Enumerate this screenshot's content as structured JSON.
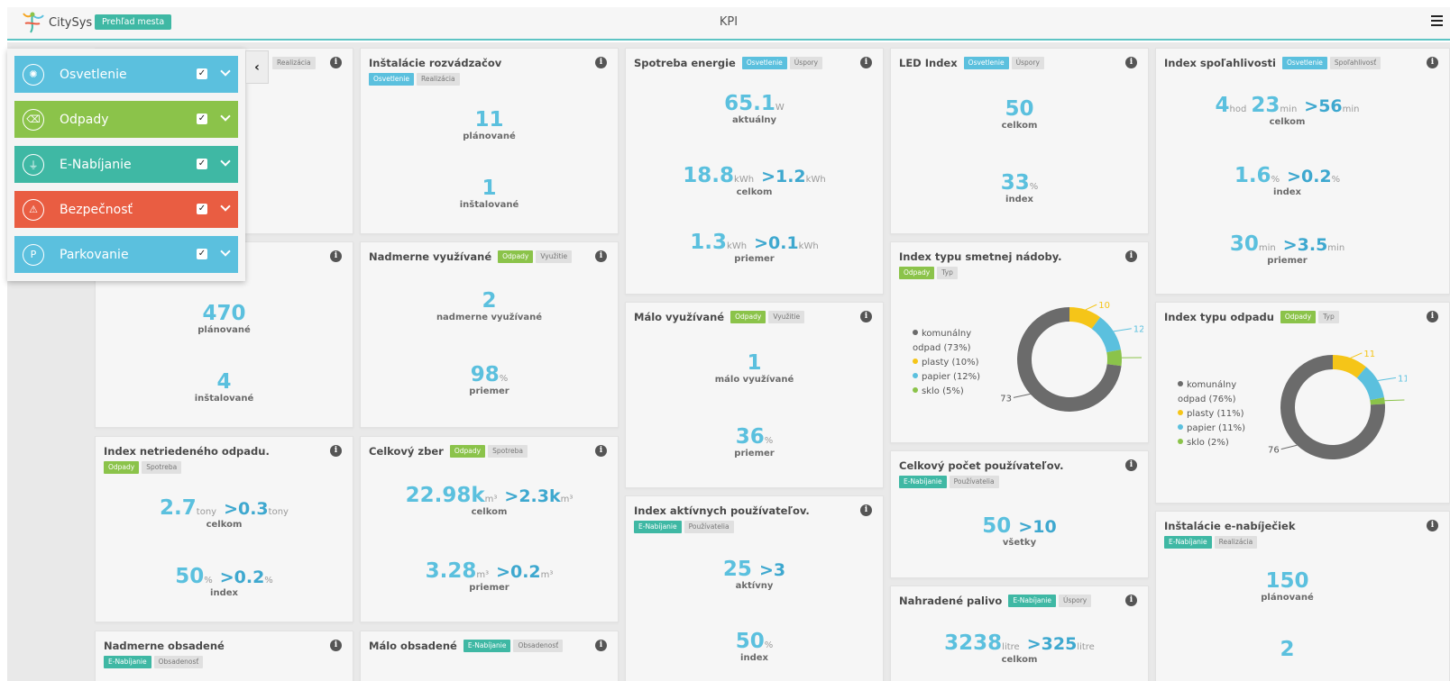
{
  "header": {
    "logo_text": "CitySys",
    "city_button": "Prehľad mesta",
    "title": "KPI",
    "menu_icon": "hamburger-icon"
  },
  "sidebar": {
    "items": [
      {
        "label": "Osvetlenie",
        "color": "#5bc0de",
        "icon": "lamp-icon",
        "checked": true
      },
      {
        "label": "Odpady",
        "color": "#8bc34a",
        "icon": "trash-icon",
        "checked": true
      },
      {
        "label": "E-Nabíjanie",
        "color": "#3fb8a4",
        "icon": "plug-icon",
        "checked": true
      },
      {
        "label": "Bezpečnosť",
        "color": "#e95d42",
        "icon": "alarm-icon",
        "checked": true
      },
      {
        "label": "Parkovanie",
        "color": "#5bc0de",
        "icon": "parking-icon",
        "checked": true
      }
    ],
    "collapse": "‹"
  },
  "cards": {
    "c1a": {
      "tag": "Realizácia"
    },
    "c1b": {
      "v1": "470",
      "l1": "plánované",
      "v2": "4",
      "l2": "inštalované"
    },
    "c1c": {
      "title": "Index netriedeného odpadu.",
      "tags": [
        "Odpady",
        "Spotreba"
      ],
      "v1": "2.7",
      "u1": "tony",
      "c1": ">0.3",
      "cu1": "tony",
      "l1": "celkom",
      "v2": "50",
      "u2": "%",
      "c2": ">0.2",
      "cu2": "%",
      "l2": "index"
    },
    "c1d": {
      "title": "Nadmerne obsadené",
      "tags": [
        "E-Nabíjanie",
        "Obsadenosť"
      ]
    },
    "c2a": {
      "title": "Inštalácie rozvádzačov",
      "tags": [
        "Osvetlenie",
        "Realizácia"
      ],
      "v1": "11",
      "l1": "plánované",
      "v2": "1",
      "l2": "inštalované"
    },
    "c2b": {
      "title": "Nadmerne využívané",
      "tags": [
        "Odpady",
        "Využitie"
      ],
      "v1": "2",
      "l1": "nadmerne využívané",
      "v2": "98",
      "u2": "%",
      "l2": "priemer"
    },
    "c2c": {
      "title": "Celkový zber",
      "tags": [
        "Odpady",
        "Spotreba"
      ],
      "v1": "22.98k",
      "u1": "m³",
      "c1": ">2.3k",
      "cu1": "m³",
      "l1": "celkom",
      "v2": "3.28",
      "u2": "m³",
      "c2": ">0.2",
      "cu2": "m³",
      "l2": "priemer"
    },
    "c2d": {
      "title": "Málo obsadené",
      "tags": [
        "E-Nabíjanie",
        "Obsadenosť"
      ]
    },
    "c3a": {
      "title": "Spotreba energie",
      "tags": [
        "Osvetlenie",
        "Úspory"
      ],
      "v1": "65.1",
      "u1": "W",
      "l1": "aktuálny",
      "v2": "18.8",
      "u2": "kWh",
      "c2": ">1.2",
      "cu2": "kWh",
      "l2": "celkom",
      "v3": "1.3",
      "u3": "kWh",
      "c3": ">0.1",
      "cu3": "kWh",
      "l3": "priemer"
    },
    "c3b": {
      "title": "Málo využívané",
      "tags": [
        "Odpady",
        "Využitie"
      ],
      "v1": "1",
      "l1": "málo využívané",
      "v2": "36",
      "u2": "%",
      "l2": "priemer"
    },
    "c3c": {
      "title": "Index aktívnych používateľov.",
      "tags": [
        "E-Nabíjanie",
        "Používatelia"
      ],
      "v1": "25",
      "c1": ">3",
      "l1": "aktívny",
      "v2": "50",
      "u2": "%",
      "l2": "index"
    },
    "c4a": {
      "title": "LED Index",
      "tags": [
        "Osvetlenie",
        "Úspory"
      ],
      "v1": "50",
      "l1": "celkom",
      "v2": "33",
      "u2": "%",
      "l2": "index"
    },
    "c4b": {
      "title": "Index typu smetnej nádoby.",
      "tags": [
        "Odpady",
        "Typ"
      ]
    },
    "c4c": {
      "title": "Celkový počet používateľov.",
      "tags": [
        "E-Nabíjanie",
        "Používatelia"
      ],
      "v1": "50",
      "c1": ">10",
      "l1": "všetky"
    },
    "c4d": {
      "title": "Nahradené palivo",
      "tags": [
        "E-Nabíjanie",
        "Úspory"
      ],
      "v1": "3238",
      "u1": "litre",
      "c1": ">325",
      "cu1": "litre",
      "l1": "celkom"
    },
    "c5a": {
      "title": "Index spoľahlivosti",
      "tags": [
        "Osvetlenie",
        "Spoľahlivosť"
      ],
      "v1a": "4",
      "u1a": "hod",
      "v1b": "23",
      "u1b": "min",
      "c1": ">56",
      "cu1": "min",
      "l1": "celkom",
      "v2": "1.6",
      "u2": "%",
      "c2": ">0.2",
      "cu2": "%",
      "l2": "index",
      "v3": "30",
      "u3": "min",
      "c3": ">3.5",
      "cu3": "min",
      "l3": "priemer"
    },
    "c5b": {
      "title": "Index typu odpadu",
      "tags": [
        "Odpady",
        "Typ"
      ]
    },
    "c5c": {
      "title": "Inštalácie e-nabíječiek",
      "tags": [
        "E-Nabíjanie",
        "Realizácia"
      ],
      "v1": "150",
      "l1": "plánované",
      "v2": "2"
    }
  },
  "chart_data": [
    {
      "type": "pie",
      "series": [
        {
          "name": "komunálny odpad",
          "values": [
            73
          ]
        },
        {
          "name": "plasty",
          "values": [
            10
          ]
        },
        {
          "name": "papier",
          "values": [
            12
          ]
        },
        {
          "name": "sklo",
          "values": [
            5
          ]
        }
      ],
      "legend": [
        "komunálny odpad (73%)",
        "plasty (10%)",
        "papier (12%)",
        "sklo (5%)"
      ],
      "labels": [
        "73",
        "10",
        "12",
        "5"
      ],
      "values": [
        73,
        10,
        12,
        5
      ],
      "colors": [
        "#6b6b6b",
        "#f5c518",
        "#5bc0de",
        "#8bc34a"
      ],
      "legend_placement": "left"
    },
    {
      "type": "pie",
      "series": [
        {
          "name": "komunálny odpad",
          "values": [
            76
          ]
        },
        {
          "name": "plasty",
          "values": [
            11
          ]
        },
        {
          "name": "papier",
          "values": [
            11
          ]
        },
        {
          "name": "sklo",
          "values": [
            2
          ]
        }
      ],
      "legend": [
        "komunálny odpad (76%)",
        "plasty (11%)",
        "papier (11%)",
        "sklo (2%)"
      ],
      "labels": [
        "76",
        "11",
        "11",
        "2"
      ],
      "values": [
        76,
        11,
        11,
        2
      ],
      "colors": [
        "#6b6b6b",
        "#f5c518",
        "#5bc0de",
        "#8bc34a"
      ],
      "legend_placement": "left"
    }
  ]
}
